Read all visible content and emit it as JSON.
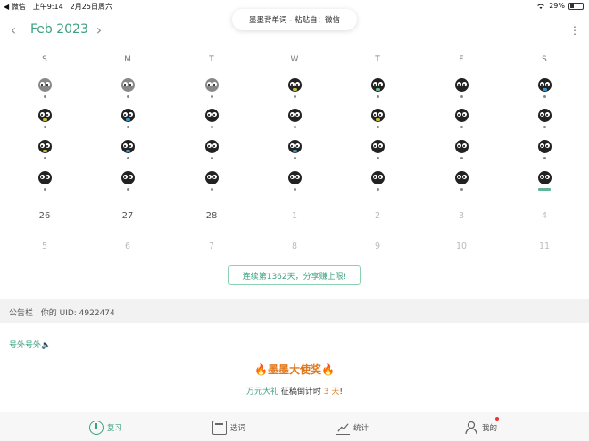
{
  "status": {
    "back_app": "◀ 微信",
    "time": "上午9:14",
    "date": "2月25日周六",
    "battery": "29%"
  },
  "toast": {
    "text": "墨墨背单词 - 粘贴自：微信"
  },
  "calendar": {
    "month_label": "Feb 2023",
    "prev_label": "‹",
    "next_label": "›",
    "more_label": "⋮",
    "weekdays": [
      "S",
      "M",
      "T",
      "W",
      "T",
      "F",
      "S"
    ],
    "face_rows": [
      [
        "grey",
        "grey",
        "grey",
        "yellow",
        "green",
        "none",
        "blue"
      ],
      [
        "yellow",
        "blue",
        "none",
        "none",
        "yellow",
        "none",
        "none"
      ],
      [
        "yellow",
        "blue",
        "none",
        "blue",
        "none",
        "none",
        "none"
      ],
      [
        "none",
        "none",
        "none",
        "none",
        "none",
        "none",
        "today"
      ]
    ],
    "date_rows": [
      [
        "26",
        "27",
        "28",
        "1",
        "2",
        "3",
        "4"
      ],
      [
        "5",
        "6",
        "7",
        "8",
        "9",
        "10",
        "11"
      ]
    ],
    "dim_from_index": 3,
    "streak_label": "连续第1362天，分享赚上限!"
  },
  "notice": {
    "text": "公告栏 | 你的 UID: 4922474"
  },
  "promo": {
    "section_label": "号外号外🔈",
    "title": "🔥墨墨大使奖🔥",
    "sub_part1": "万元大礼",
    "sub_part2": " 征稿倒计时 ",
    "sub_part3": "3 天",
    "sub_part4": "!"
  },
  "tabbar": {
    "review": "复习",
    "select": "选词",
    "stats": "统计",
    "me": "我的"
  },
  "colors": {
    "accent": "#3aa27c",
    "orange": "#e07a20"
  }
}
